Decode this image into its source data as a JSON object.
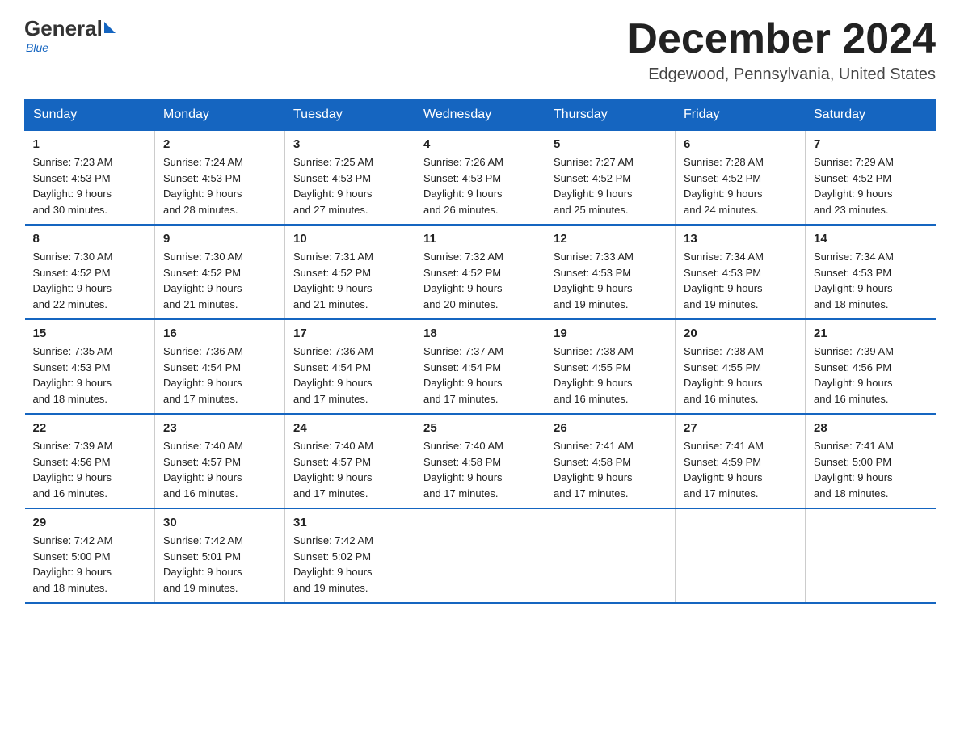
{
  "logo": {
    "general": "General",
    "blue": "Blue",
    "tagline": "Blue"
  },
  "title": "December 2024",
  "location": "Edgewood, Pennsylvania, United States",
  "days_of_week": [
    "Sunday",
    "Monday",
    "Tuesday",
    "Wednesday",
    "Thursday",
    "Friday",
    "Saturday"
  ],
  "weeks": [
    [
      {
        "day": "1",
        "sunrise": "7:23 AM",
        "sunset": "4:53 PM",
        "daylight": "9 hours and 30 minutes."
      },
      {
        "day": "2",
        "sunrise": "7:24 AM",
        "sunset": "4:53 PM",
        "daylight": "9 hours and 28 minutes."
      },
      {
        "day": "3",
        "sunrise": "7:25 AM",
        "sunset": "4:53 PM",
        "daylight": "9 hours and 27 minutes."
      },
      {
        "day": "4",
        "sunrise": "7:26 AM",
        "sunset": "4:53 PM",
        "daylight": "9 hours and 26 minutes."
      },
      {
        "day": "5",
        "sunrise": "7:27 AM",
        "sunset": "4:52 PM",
        "daylight": "9 hours and 25 minutes."
      },
      {
        "day": "6",
        "sunrise": "7:28 AM",
        "sunset": "4:52 PM",
        "daylight": "9 hours and 24 minutes."
      },
      {
        "day": "7",
        "sunrise": "7:29 AM",
        "sunset": "4:52 PM",
        "daylight": "9 hours and 23 minutes."
      }
    ],
    [
      {
        "day": "8",
        "sunrise": "7:30 AM",
        "sunset": "4:52 PM",
        "daylight": "9 hours and 22 minutes."
      },
      {
        "day": "9",
        "sunrise": "7:30 AM",
        "sunset": "4:52 PM",
        "daylight": "9 hours and 21 minutes."
      },
      {
        "day": "10",
        "sunrise": "7:31 AM",
        "sunset": "4:52 PM",
        "daylight": "9 hours and 21 minutes."
      },
      {
        "day": "11",
        "sunrise": "7:32 AM",
        "sunset": "4:52 PM",
        "daylight": "9 hours and 20 minutes."
      },
      {
        "day": "12",
        "sunrise": "7:33 AM",
        "sunset": "4:53 PM",
        "daylight": "9 hours and 19 minutes."
      },
      {
        "day": "13",
        "sunrise": "7:34 AM",
        "sunset": "4:53 PM",
        "daylight": "9 hours and 19 minutes."
      },
      {
        "day": "14",
        "sunrise": "7:34 AM",
        "sunset": "4:53 PM",
        "daylight": "9 hours and 18 minutes."
      }
    ],
    [
      {
        "day": "15",
        "sunrise": "7:35 AM",
        "sunset": "4:53 PM",
        "daylight": "9 hours and 18 minutes."
      },
      {
        "day": "16",
        "sunrise": "7:36 AM",
        "sunset": "4:54 PM",
        "daylight": "9 hours and 17 minutes."
      },
      {
        "day": "17",
        "sunrise": "7:36 AM",
        "sunset": "4:54 PM",
        "daylight": "9 hours and 17 minutes."
      },
      {
        "day": "18",
        "sunrise": "7:37 AM",
        "sunset": "4:54 PM",
        "daylight": "9 hours and 17 minutes."
      },
      {
        "day": "19",
        "sunrise": "7:38 AM",
        "sunset": "4:55 PM",
        "daylight": "9 hours and 16 minutes."
      },
      {
        "day": "20",
        "sunrise": "7:38 AM",
        "sunset": "4:55 PM",
        "daylight": "9 hours and 16 minutes."
      },
      {
        "day": "21",
        "sunrise": "7:39 AM",
        "sunset": "4:56 PM",
        "daylight": "9 hours and 16 minutes."
      }
    ],
    [
      {
        "day": "22",
        "sunrise": "7:39 AM",
        "sunset": "4:56 PM",
        "daylight": "9 hours and 16 minutes."
      },
      {
        "day": "23",
        "sunrise": "7:40 AM",
        "sunset": "4:57 PM",
        "daylight": "9 hours and 16 minutes."
      },
      {
        "day": "24",
        "sunrise": "7:40 AM",
        "sunset": "4:57 PM",
        "daylight": "9 hours and 17 minutes."
      },
      {
        "day": "25",
        "sunrise": "7:40 AM",
        "sunset": "4:58 PM",
        "daylight": "9 hours and 17 minutes."
      },
      {
        "day": "26",
        "sunrise": "7:41 AM",
        "sunset": "4:58 PM",
        "daylight": "9 hours and 17 minutes."
      },
      {
        "day": "27",
        "sunrise": "7:41 AM",
        "sunset": "4:59 PM",
        "daylight": "9 hours and 17 minutes."
      },
      {
        "day": "28",
        "sunrise": "7:41 AM",
        "sunset": "5:00 PM",
        "daylight": "9 hours and 18 minutes."
      }
    ],
    [
      {
        "day": "29",
        "sunrise": "7:42 AM",
        "sunset": "5:00 PM",
        "daylight": "9 hours and 18 minutes."
      },
      {
        "day": "30",
        "sunrise": "7:42 AM",
        "sunset": "5:01 PM",
        "daylight": "9 hours and 19 minutes."
      },
      {
        "day": "31",
        "sunrise": "7:42 AM",
        "sunset": "5:02 PM",
        "daylight": "9 hours and 19 minutes."
      },
      null,
      null,
      null,
      null
    ]
  ],
  "labels": {
    "sunrise": "Sunrise:",
    "sunset": "Sunset:",
    "daylight": "Daylight:"
  }
}
